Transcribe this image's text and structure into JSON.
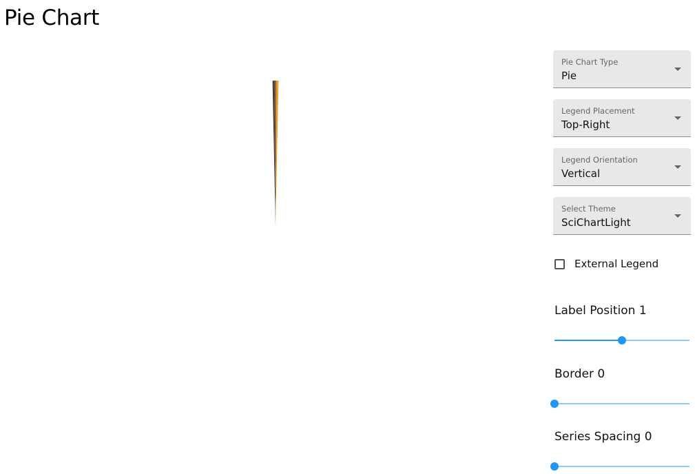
{
  "page": {
    "title": "Pie Chart"
  },
  "chart_data": {
    "type": "pie",
    "title": "",
    "slice_colors": [
      "#3a3a3a",
      "#6b4a3a",
      "#c0843a",
      "#f0a020"
    ],
    "legend": {
      "shown": false
    },
    "note_values_not_readable": ""
  },
  "controls": {
    "pie_chart_type": {
      "label": "Pie Chart Type",
      "value": "Pie"
    },
    "legend_placement": {
      "label": "Legend Placement",
      "value": "Top-Right"
    },
    "legend_orientation": {
      "label": "Legend Orientation",
      "value": "Vertical"
    },
    "theme": {
      "label": "Select Theme",
      "value": "SciChartLight"
    },
    "external_legend": {
      "label": "External Legend",
      "checked": false
    },
    "label_position": {
      "title": "Label Position 1",
      "value": 1,
      "fraction": 0.5
    },
    "border": {
      "title": "Border 0",
      "value": 0,
      "fraction": 0
    },
    "series_spacing": {
      "title": "Series Spacing 0",
      "value": 0,
      "fraction": 0
    }
  },
  "colors": {
    "accent": "#2196f3",
    "track": "#90caf9",
    "field_bg": "#e8e8e8"
  }
}
